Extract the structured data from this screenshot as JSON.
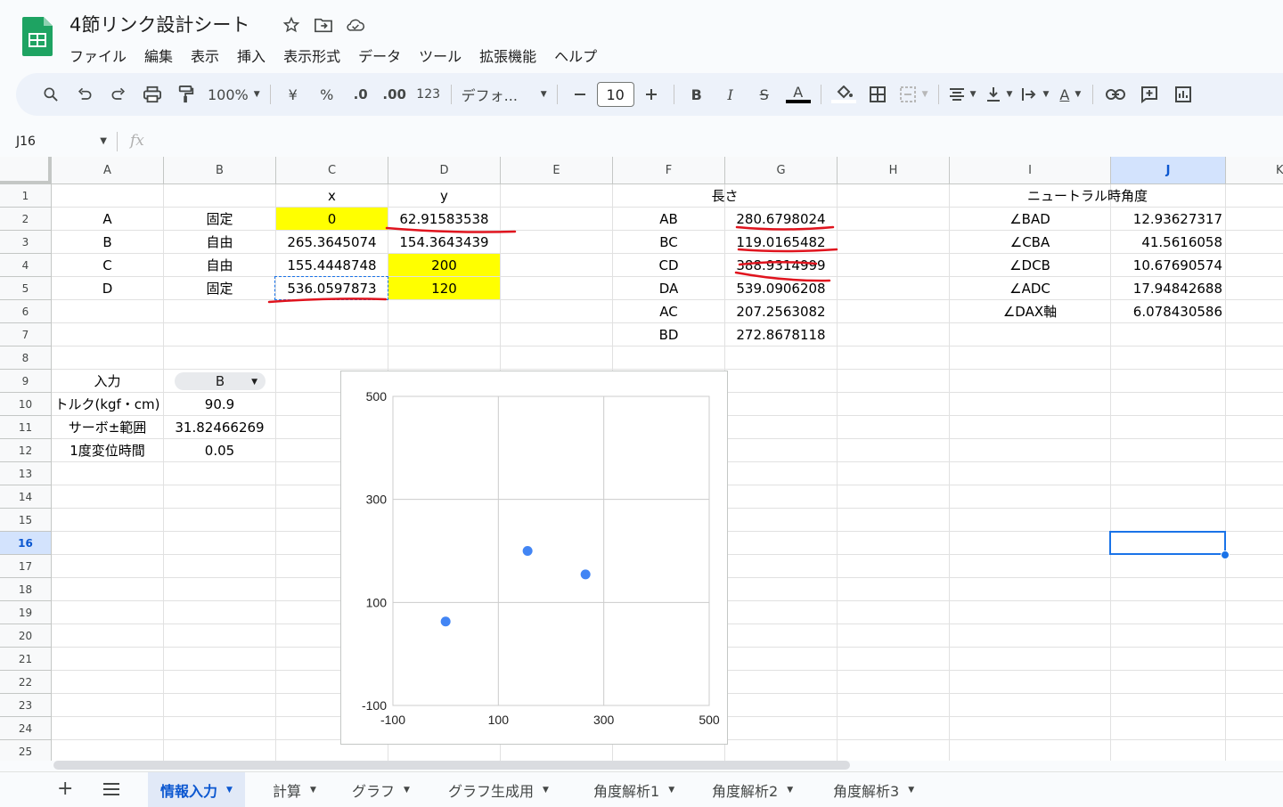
{
  "title": "4節リンク設計シート",
  "menu": [
    "ファイル",
    "編集",
    "表示",
    "挿入",
    "表示形式",
    "データ",
    "ツール",
    "拡張機能",
    "ヘルプ"
  ],
  "toolbar": {
    "zoom": "100%",
    "currency": "¥",
    "percent": "%",
    "dec_less": ".0",
    "dec_more": ".00",
    "number_format": "123",
    "font": "デフォ...",
    "font_size": "10",
    "icons": [
      "search-icon",
      "undo-icon",
      "redo-icon",
      "print-icon",
      "paint-format-icon",
      "bold-icon",
      "italic-icon",
      "strikethrough-icon",
      "text-color-icon",
      "fill-color-icon",
      "borders-icon",
      "merge-icon",
      "align-icon",
      "valign-icon",
      "wrap-icon",
      "rotate-icon",
      "link-icon",
      "comment-icon",
      "chart-icon"
    ]
  },
  "namebox": "J16",
  "fx": "fx",
  "columns": [
    "A",
    "B",
    "C",
    "D",
    "E",
    "F",
    "G",
    "H",
    "I",
    "J",
    "K"
  ],
  "selected_column": "J",
  "rows": [
    "1",
    "2",
    "3",
    "4",
    "5",
    "6",
    "7",
    "8",
    "9",
    "10",
    "11",
    "12",
    "13",
    "14",
    "15",
    "16",
    "17",
    "18",
    "19",
    "20",
    "21",
    "22",
    "23",
    "24",
    "25"
  ],
  "selected_row": "16",
  "cells": {
    "C1": "x",
    "D1": "y",
    "F1": "長さ",
    "I1": "ニュートラル時角度",
    "A2": "A",
    "B2": "固定",
    "C2": "0",
    "D2": "62.91583538",
    "F2": "AB",
    "G2": "280.6798024",
    "I2": "∠BAD",
    "J2": "12.93627317",
    "A3": "B",
    "B3": "自由",
    "C3": "265.3645074",
    "D3": "154.3643439",
    "F3": "BC",
    "G3": "119.0165482",
    "I3": "∠CBA",
    "J3": "41.5616058",
    "A4": "C",
    "B4": "自由",
    "C4": "155.4448748",
    "D4": "200",
    "F4": "CD",
    "G4": "388.9314999",
    "I4": "∠DCB",
    "J4": "10.67690574",
    "A5": "D",
    "B5": "固定",
    "C5": "536.0597873",
    "D5": "120",
    "F5": "DA",
    "G5": "539.0906208",
    "I5": "∠ADC",
    "J5": "17.94842688",
    "F6": "AC",
    "G6": "207.2563082",
    "I6": "∠DAX軸",
    "J6": "6.078430586",
    "F7": "BD",
    "G7": "272.8678118",
    "A9": "入力",
    "B9": "B",
    "A10": "トルク(kgf・cm)",
    "B10": "90.9",
    "A11": "サーボ±範囲",
    "B11": "31.82466269",
    "A12": "1度変位時間",
    "B12": "0.05"
  },
  "colors": {
    "highlight": "#ffff00",
    "selection": "#1a73e8",
    "annotation": "#e0141e",
    "point": "#4285f4"
  },
  "chart_data": {
    "type": "scatter",
    "points": [
      {
        "x": 0,
        "y": 62.91583538
      },
      {
        "x": 265.3645074,
        "y": 154.3643439
      },
      {
        "x": 155.4448748,
        "y": 200
      }
    ],
    "xlim": [
      -100,
      500
    ],
    "ylim": [
      -100,
      500
    ],
    "xticks": [
      "-100",
      "100",
      "300",
      "500"
    ],
    "yticks": [
      "500",
      "300",
      "100",
      "-100"
    ],
    "grid": true
  },
  "sheet_tabs": [
    "情報入力",
    "計算",
    "グラフ",
    "グラフ生成用",
    "角度解析1",
    "角度解析2",
    "角度解析3"
  ],
  "active_tab": "情報入力"
}
